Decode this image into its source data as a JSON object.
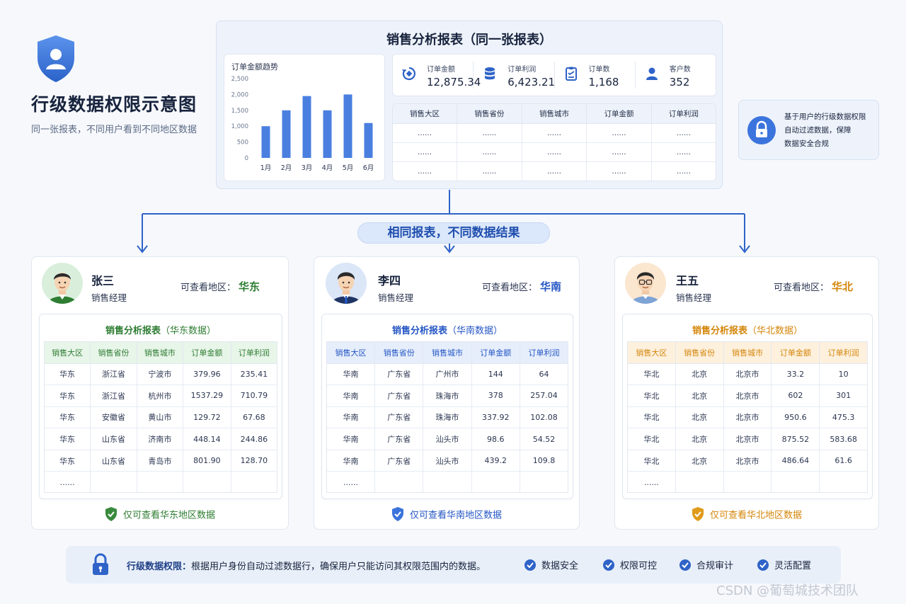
{
  "header": {
    "title": "行级数据权限示意图",
    "subtitle": "同一张报表，不同用户看到不同地区数据"
  },
  "report": {
    "title": "销售分析报表（同一张报表）",
    "trend_title": "订单金额趋势",
    "kpis": [
      {
        "label": "订单金额",
        "value": "12,875.34",
        "icon": "refresh-icon"
      },
      {
        "label": "订单利润",
        "value": "6,423.21",
        "icon": "database-icon"
      },
      {
        "label": "订单数",
        "value": "1,168",
        "icon": "clipboard-icon"
      },
      {
        "label": "客户数",
        "value": "352",
        "icon": "user-icon"
      }
    ],
    "columns": [
      "销售大区",
      "销售省份",
      "销售城市",
      "订单金额",
      "订单利润"
    ],
    "placeholder_rows": [
      [
        "......",
        "......",
        "......",
        "......",
        "......"
      ],
      [
        "......",
        "......",
        "......",
        "......",
        "......"
      ],
      [
        "......",
        "......",
        "......",
        "......",
        "......"
      ]
    ]
  },
  "chart_data": {
    "type": "bar",
    "title": "订单金额趋势",
    "categories": [
      "1月",
      "2月",
      "3月",
      "4月",
      "5月",
      "6月"
    ],
    "values": [
      1000,
      1500,
      1950,
      1500,
      2000,
      1100
    ],
    "ylim": [
      0,
      2500
    ],
    "yticks": [
      "0",
      "500",
      "1,000",
      "1,500",
      "2,000",
      "2,500"
    ],
    "color": "#4a7fe0",
    "grid": false
  },
  "banner": "相同报表，不同数据结果",
  "callout": {
    "line1": "基于用户的行级数据权限",
    "line2": "自动过滤数据，保障",
    "line3": "数据安全合规",
    "icon": "lock-icon"
  },
  "users": [
    {
      "name": "张三",
      "role": "销售经理",
      "region_label": "可查看地区：",
      "region": "华东",
      "accent": "#2e7d32",
      "report_title": "销售分析报表",
      "report_subtitle": "（华东数据）",
      "columns": [
        "销售大区",
        "销售省份",
        "销售城市",
        "订单金额",
        "订单利润"
      ],
      "rows": [
        [
          "华东",
          "浙江省",
          "宁波市",
          "379.96",
          "235.41"
        ],
        [
          "华东",
          "浙江省",
          "杭州市",
          "1537.29",
          "710.79"
        ],
        [
          "华东",
          "安徽省",
          "黄山市",
          "129.72",
          "67.68"
        ],
        [
          "华东",
          "山东省",
          "济南市",
          "448.14",
          "244.86"
        ],
        [
          "华东",
          "山东省",
          "青岛市",
          "801.90",
          "128.70"
        ],
        [
          "......",
          "",
          "",
          "",
          ""
        ]
      ],
      "footer": "仅可查看华东地区数据"
    },
    {
      "name": "李四",
      "role": "销售经理",
      "region_label": "可查看地区：",
      "region": "华南",
      "accent": "#2456c4",
      "report_title": "销售分析报表",
      "report_subtitle": "（华南数据）",
      "columns": [
        "销售大区",
        "销售省份",
        "销售城市",
        "订单金额",
        "订单利润"
      ],
      "rows": [
        [
          "华南",
          "广东省",
          "广州市",
          "144",
          "64"
        ],
        [
          "华南",
          "广东省",
          "珠海市",
          "378",
          "257.04"
        ],
        [
          "华南",
          "广东省",
          "珠海市",
          "337.92",
          "102.08"
        ],
        [
          "华南",
          "广东省",
          "汕头市",
          "98.6",
          "54.52"
        ],
        [
          "华南",
          "广东省",
          "汕头市",
          "439.2",
          "109.8"
        ],
        [
          "......",
          "",
          "",
          "",
          ""
        ]
      ],
      "footer": "仅可查看华南地区数据"
    },
    {
      "name": "王五",
      "role": "销售经理",
      "region_label": "可查看地区：",
      "region": "华北",
      "accent": "#d4860b",
      "report_title": "销售分析报表",
      "report_subtitle": "（华北数据）",
      "columns": [
        "销售大区",
        "销售省份",
        "销售城市",
        "订单金额",
        "订单利润"
      ],
      "rows": [
        [
          "华北",
          "北京",
          "北京市",
          "33.2",
          "10"
        ],
        [
          "华北",
          "北京",
          "北京市",
          "602",
          "301"
        ],
        [
          "华北",
          "北京",
          "北京市",
          "950.6",
          "475.3"
        ],
        [
          "华北",
          "北京",
          "北京市",
          "875.52",
          "583.68"
        ],
        [
          "华北",
          "北京",
          "北京市",
          "486.64",
          "61.6"
        ],
        [
          "......",
          "",
          "",
          "",
          ""
        ]
      ],
      "footer": "仅可查看华北地区数据"
    }
  ],
  "bottom": {
    "label": "行级数据权限：",
    "text": "根据用户身份自动过滤数据行，确保用户只能访问其权限范围内的数据。",
    "features": [
      "数据安全",
      "权限可控",
      "合规审计",
      "灵活配置"
    ]
  },
  "watermark": "CSDN @葡萄城技术团队"
}
